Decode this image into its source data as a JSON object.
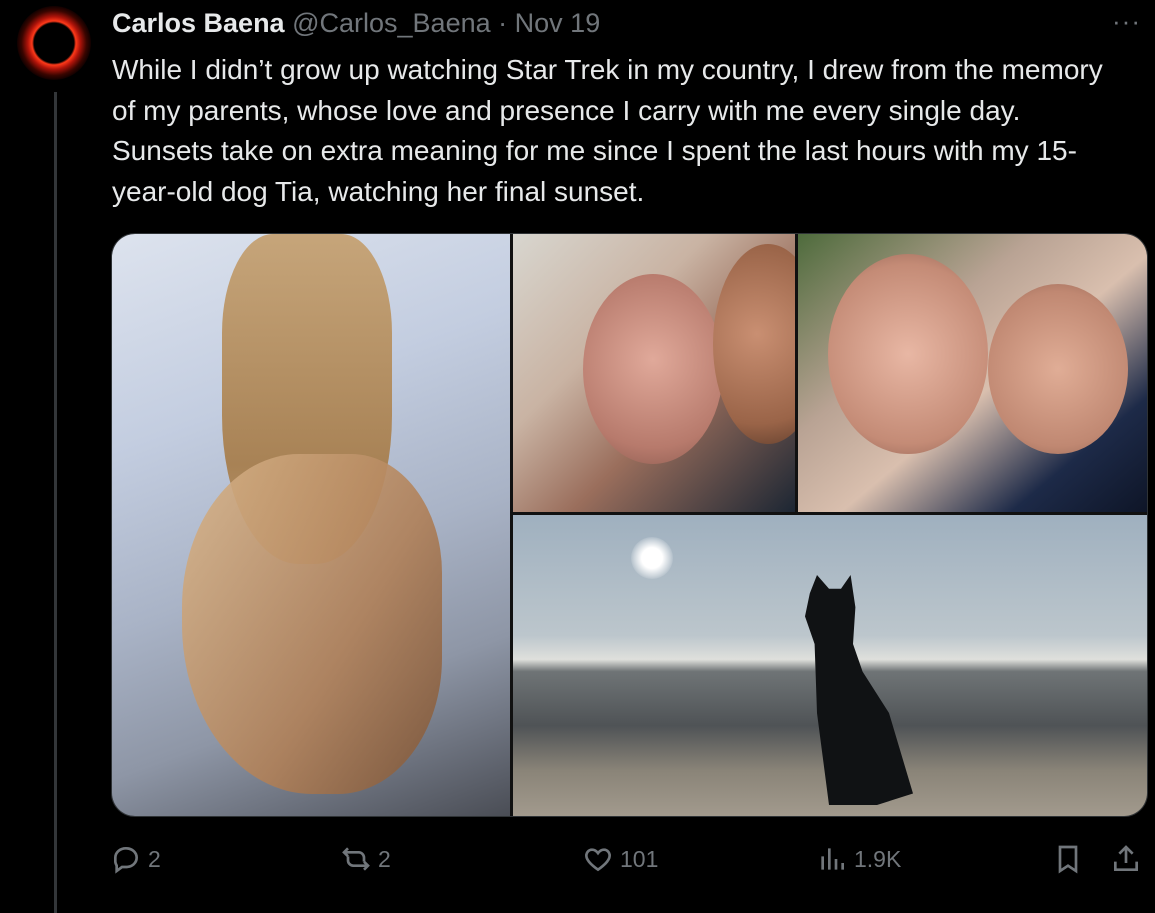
{
  "author": {
    "name": "Carlos Baena",
    "handle": "@Carlos_Baena",
    "separator": "·",
    "date": "Nov 19"
  },
  "tweet": {
    "text": "While I didn’t grow up watching Star Trek in my country, I drew from the memory of my parents, whose love and presence I carry with me every single day. Sunsets take on extra meaning for me since I spent the last hours with my 15-year-old dog Tia, watching her final sunset."
  },
  "more_menu": "···",
  "media": {
    "photos": [
      "hands-photo",
      "selfie-photo",
      "parents-photo",
      "beach-dog-photo"
    ]
  },
  "actions": {
    "replies": "2",
    "reposts": "2",
    "likes": "101",
    "views": "1.9K"
  },
  "icons": {
    "reply": "reply-icon",
    "repost": "repost-icon",
    "like": "heart-icon",
    "views": "views-icon",
    "bookmark": "bookmark-icon",
    "share": "share-icon"
  }
}
